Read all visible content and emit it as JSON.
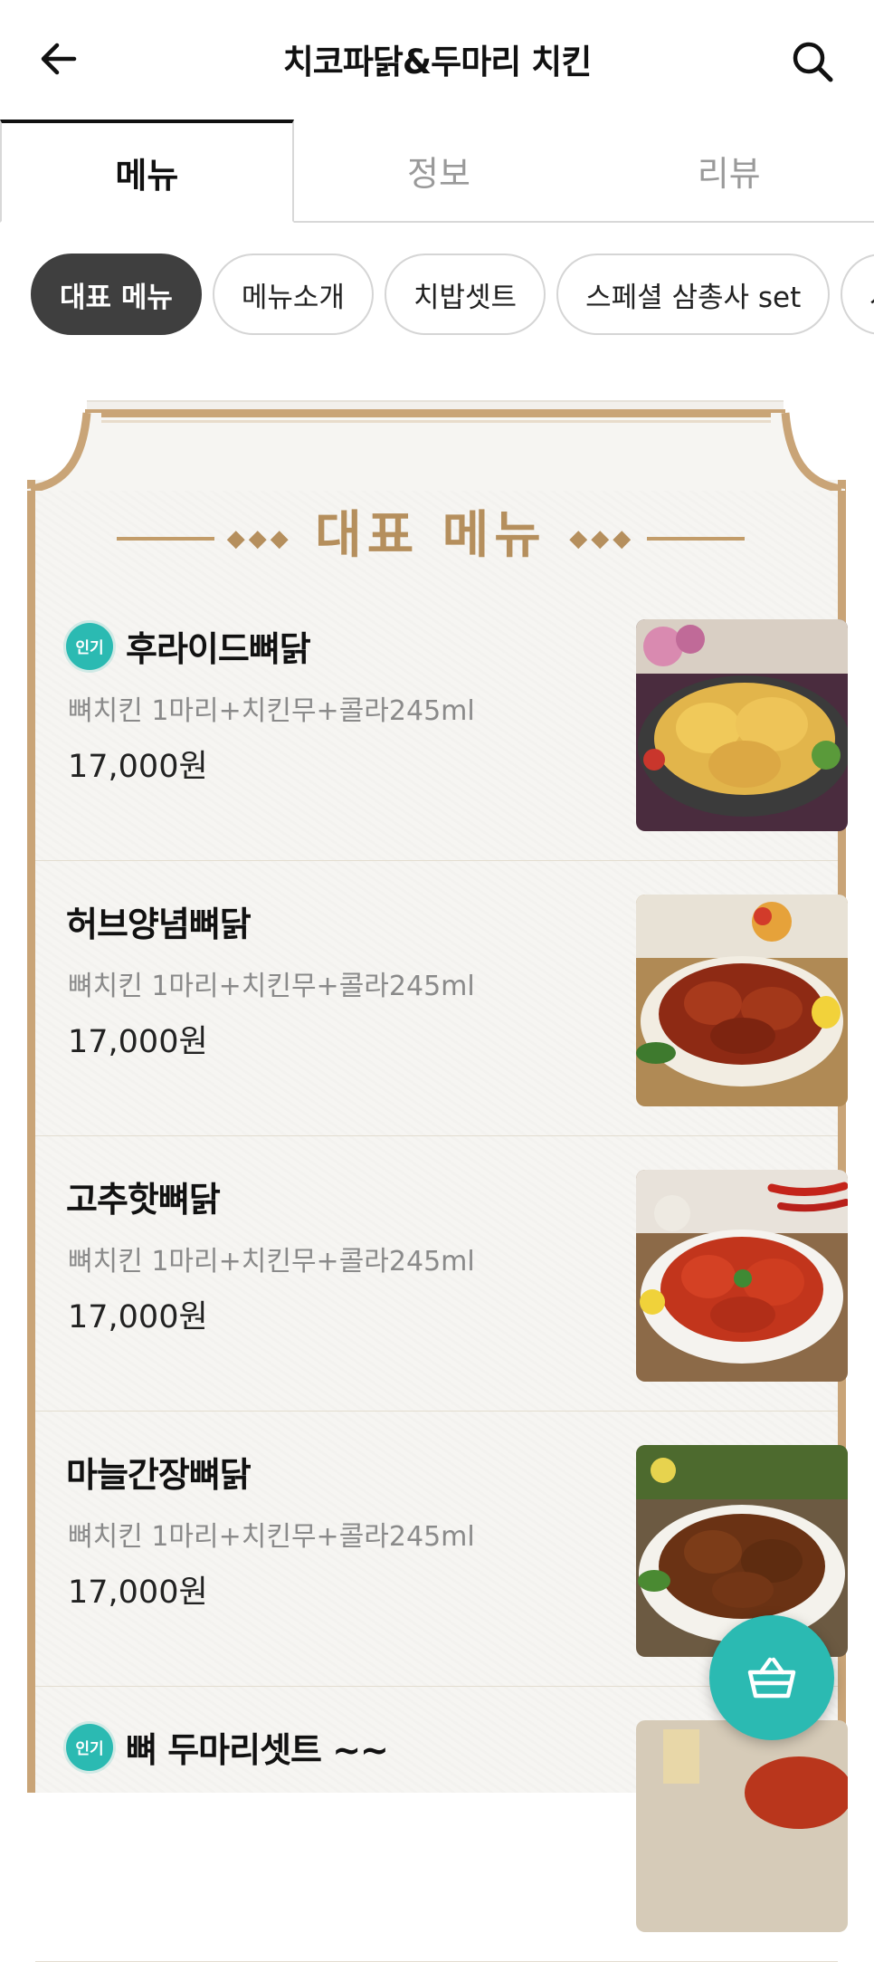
{
  "header": {
    "title": "치코파닭&두마리 치킨",
    "back_icon": "arrow-left-icon",
    "search_icon": "search-icon"
  },
  "tabs": [
    {
      "label": "메뉴",
      "active": true
    },
    {
      "label": "정보",
      "active": false
    },
    {
      "label": "리뷰",
      "active": false
    }
  ],
  "chips": [
    {
      "label": "대표 메뉴",
      "active": true
    },
    {
      "label": "메뉴소개",
      "active": false
    },
    {
      "label": "치밥셋트",
      "active": false
    },
    {
      "label": "스페셜 삼총사 set",
      "active": false
    },
    {
      "label": "사",
      "active": false
    }
  ],
  "section": {
    "title": "대표 메뉴",
    "ornament": "◆◆◆"
  },
  "items": [
    {
      "badge": "인기",
      "name": "후라이드뼈닭",
      "desc": "뼈치킨 1마리+치킨무+콜라245ml",
      "price": "17,000원"
    },
    {
      "badge": "",
      "name": "허브양념뼈닭",
      "desc": "뼈치킨 1마리+치킨무+콜라245ml",
      "price": "17,000원"
    },
    {
      "badge": "",
      "name": "고추핫뼈닭",
      "desc": "뼈치킨 1마리+치킨무+콜라245ml",
      "price": "17,000원"
    },
    {
      "badge": "",
      "name": "마늘간장뼈닭",
      "desc": "뼈치킨 1마리+치킨무+콜라245ml",
      "price": "17,000원"
    },
    {
      "badge": "인기",
      "name": "뼈  두마리셋트 ~~",
      "desc": "",
      "price": ""
    }
  ],
  "cart": {
    "icon": "basket-icon"
  },
  "colors": {
    "accent": "#2bbab2",
    "frame": "#c9a477",
    "section_title": "#b58f5d",
    "chip_active": "#3f3f3f"
  }
}
